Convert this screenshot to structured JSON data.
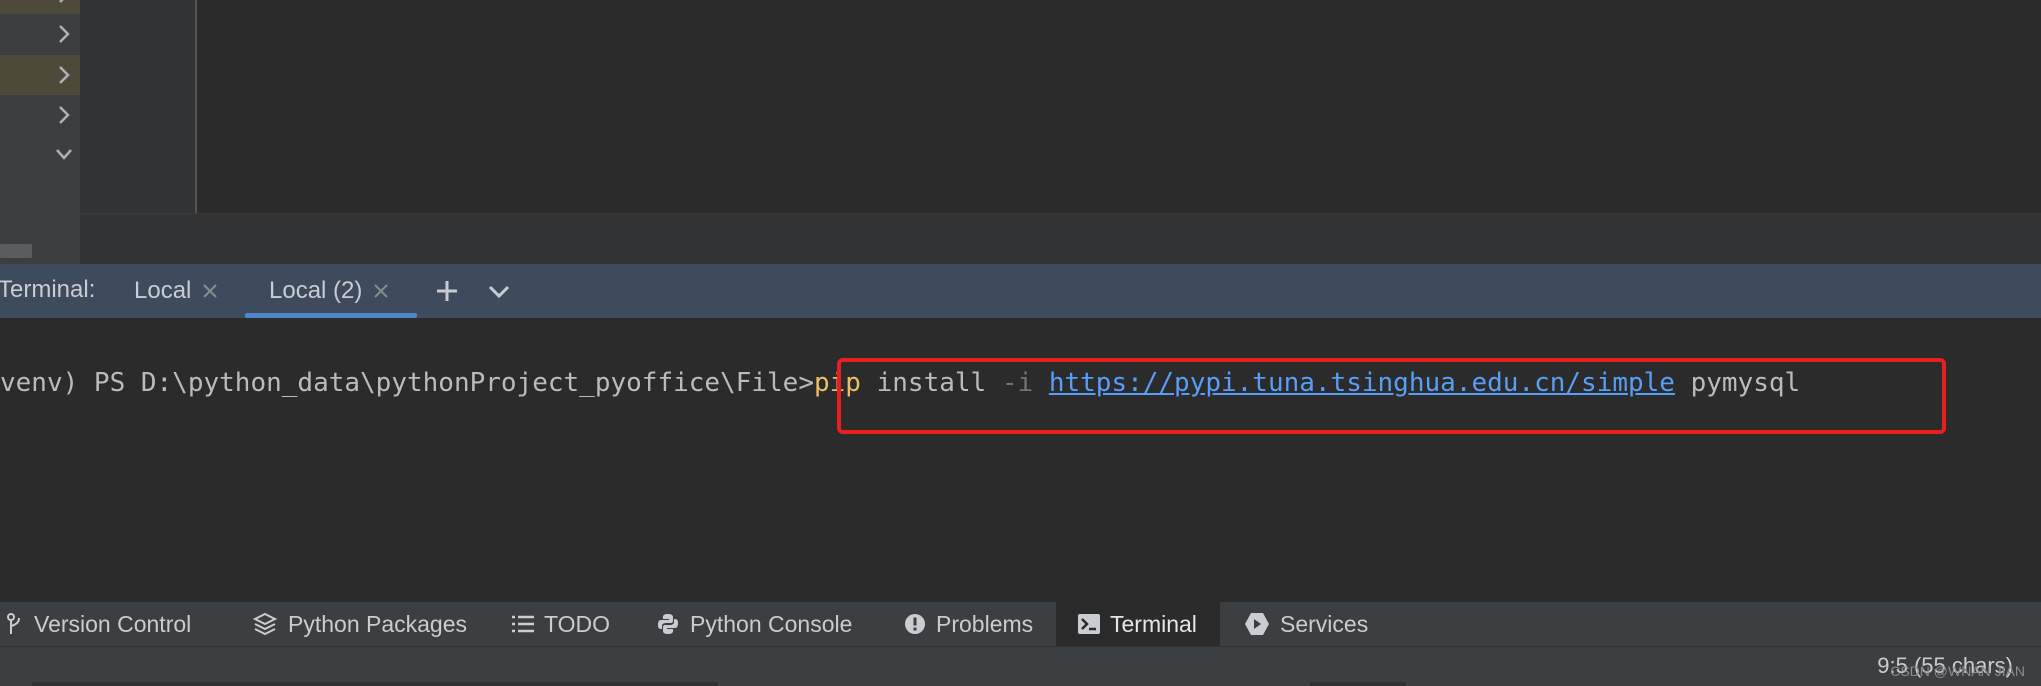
{
  "terminal": {
    "label": "Terminal:",
    "tabs": [
      {
        "label": "Local",
        "active": false
      },
      {
        "label": "Local (2)",
        "active": true
      }
    ],
    "new_tab_icon": "plus-icon",
    "dropdown_icon": "chevron-down-icon",
    "prompt": "venv) PS D:\\python_data\\pythonProject_pyoffice\\File>",
    "command": {
      "program": "pip",
      "subcommand": "install",
      "flag": "-i",
      "url": "https://pypi.tuna.tsinghua.edu.cn/simple",
      "package": "pymysql"
    }
  },
  "tool_windows": [
    {
      "label": "Version Control",
      "icon": "branch-icon"
    },
    {
      "label": "Python Packages",
      "icon": "layers-icon"
    },
    {
      "label": "TODO",
      "icon": "list-icon"
    },
    {
      "label": "Python Console",
      "icon": "python-icon"
    },
    {
      "label": "Problems",
      "icon": "alert-icon"
    },
    {
      "label": "Terminal",
      "icon": "terminal-icon",
      "active": true
    },
    {
      "label": "Services",
      "icon": "services-icon"
    }
  ],
  "status": {
    "position": "9:5 (55 chars)",
    "watermark": "CSDN @WNAN JIAN"
  },
  "colors": {
    "highlight_box": "#e81f1f",
    "url": "#589df6",
    "command": "#e8bf6a",
    "active_tab_underline": "#4a88c7"
  }
}
